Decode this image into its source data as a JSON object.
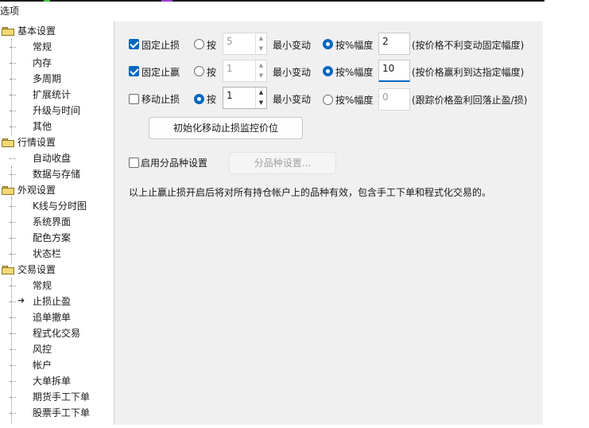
{
  "window": {
    "title": "选项"
  },
  "tree": {
    "categories": [
      {
        "label": "基本设置",
        "items": [
          "常规",
          "内存",
          "多周期",
          "扩展统计",
          "升级与时间",
          "其他"
        ]
      },
      {
        "label": "行情设置",
        "items": [
          "自动收盘",
          "数据与存储"
        ]
      },
      {
        "label": "外观设置",
        "items": [
          "K线与分时图",
          "系统界面",
          "配色方案",
          "状态栏"
        ]
      },
      {
        "label": "交易设置",
        "items": [
          "常规",
          "止损止盈",
          "追单撤单",
          "程式化交易",
          "风控",
          "帐户",
          "大单拆单",
          "期货手工下单",
          "股票手工下单"
        ]
      }
    ],
    "selected": "止损止盈"
  },
  "settings": {
    "rows": [
      {
        "checkbox_label": "固定止损",
        "checked": true,
        "radio_by_label": "按",
        "by_selected": false,
        "spin_value": "5",
        "min_change_label": "最小变动",
        "radio_pct_label": "按%幅度",
        "pct_selected": true,
        "edit_value": "2",
        "note": "(按价格不利变动固定幅度)"
      },
      {
        "checkbox_label": "固定止赢",
        "checked": true,
        "radio_by_label": "按",
        "by_selected": false,
        "spin_value": "1",
        "min_change_label": "最小变动",
        "radio_pct_label": "按%幅度",
        "pct_selected": true,
        "edit_value": "10",
        "note": "(按价格赢利到达指定幅度)"
      },
      {
        "checkbox_label": "移动止损",
        "checked": false,
        "radio_by_label": "按",
        "by_selected": true,
        "spin_value": "1",
        "min_change_label": "最小变动",
        "radio_pct_label": "按%幅度",
        "pct_selected": false,
        "edit_value": "0",
        "note": "(跟踪价格盈利回落止盈/损)"
      }
    ],
    "init_button": "初始化移动止损监控价位",
    "enable_variety_label": "启用分品种设置",
    "variety_button": "分品种设置...",
    "info_text": "以上止赢止损开启后将对所有持仓帐户上的品种有效，包含手工下单和程式化交易的。"
  },
  "colors": {
    "accent": "#0067c0",
    "panel": "#f0f0f0",
    "folder": "#f6d873"
  }
}
